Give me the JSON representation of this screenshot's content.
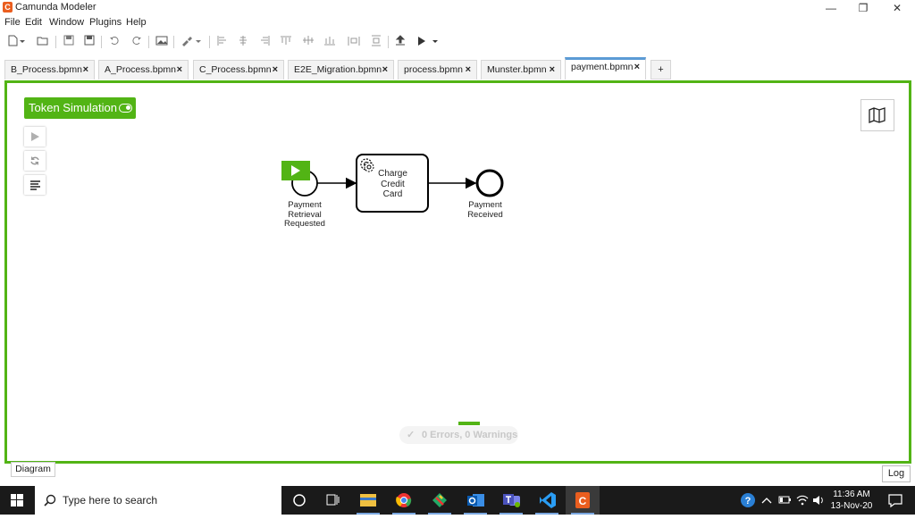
{
  "window": {
    "title": "Camunda Modeler",
    "logo_letter": "C"
  },
  "menu": [
    "File",
    "Edit",
    "Window",
    "Plugins",
    "Help"
  ],
  "tabs": [
    {
      "label": "B_Process.bpmn",
      "active": false
    },
    {
      "label": "A_Process.bpmn",
      "active": false
    },
    {
      "label": "C_Process.bpmn",
      "active": false
    },
    {
      "label": "E2E_Migration.bpmn",
      "active": false
    },
    {
      "label": "process.bpmn",
      "active": false
    },
    {
      "label": "Munster.bpmn",
      "active": false
    },
    {
      "label": "payment.bpmn",
      "active": true
    }
  ],
  "tab_close_glyph": "×",
  "tab_add_glyph": "+",
  "token_simulation": {
    "label": "Token Simulation"
  },
  "diagram": {
    "start_event_label": [
      "Payment",
      "Retrieval",
      "Requested"
    ],
    "task_label": [
      "Charge",
      "Credit",
      "Card"
    ],
    "end_event_label": [
      "Payment",
      "Received"
    ]
  },
  "status": {
    "text": "0 Errors, 0 Warnings",
    "check": "✓"
  },
  "bottom": {
    "diagram_tab": "Diagram",
    "log_button": "Log"
  },
  "taskbar": {
    "search_placeholder": "Type here to search",
    "time": "11:36 AM",
    "date": "13-Nov-20"
  },
  "colors": {
    "accent_green": "#52b415",
    "tab_active": "#5b9bd5",
    "camunda_orange": "#ea5e1f"
  }
}
